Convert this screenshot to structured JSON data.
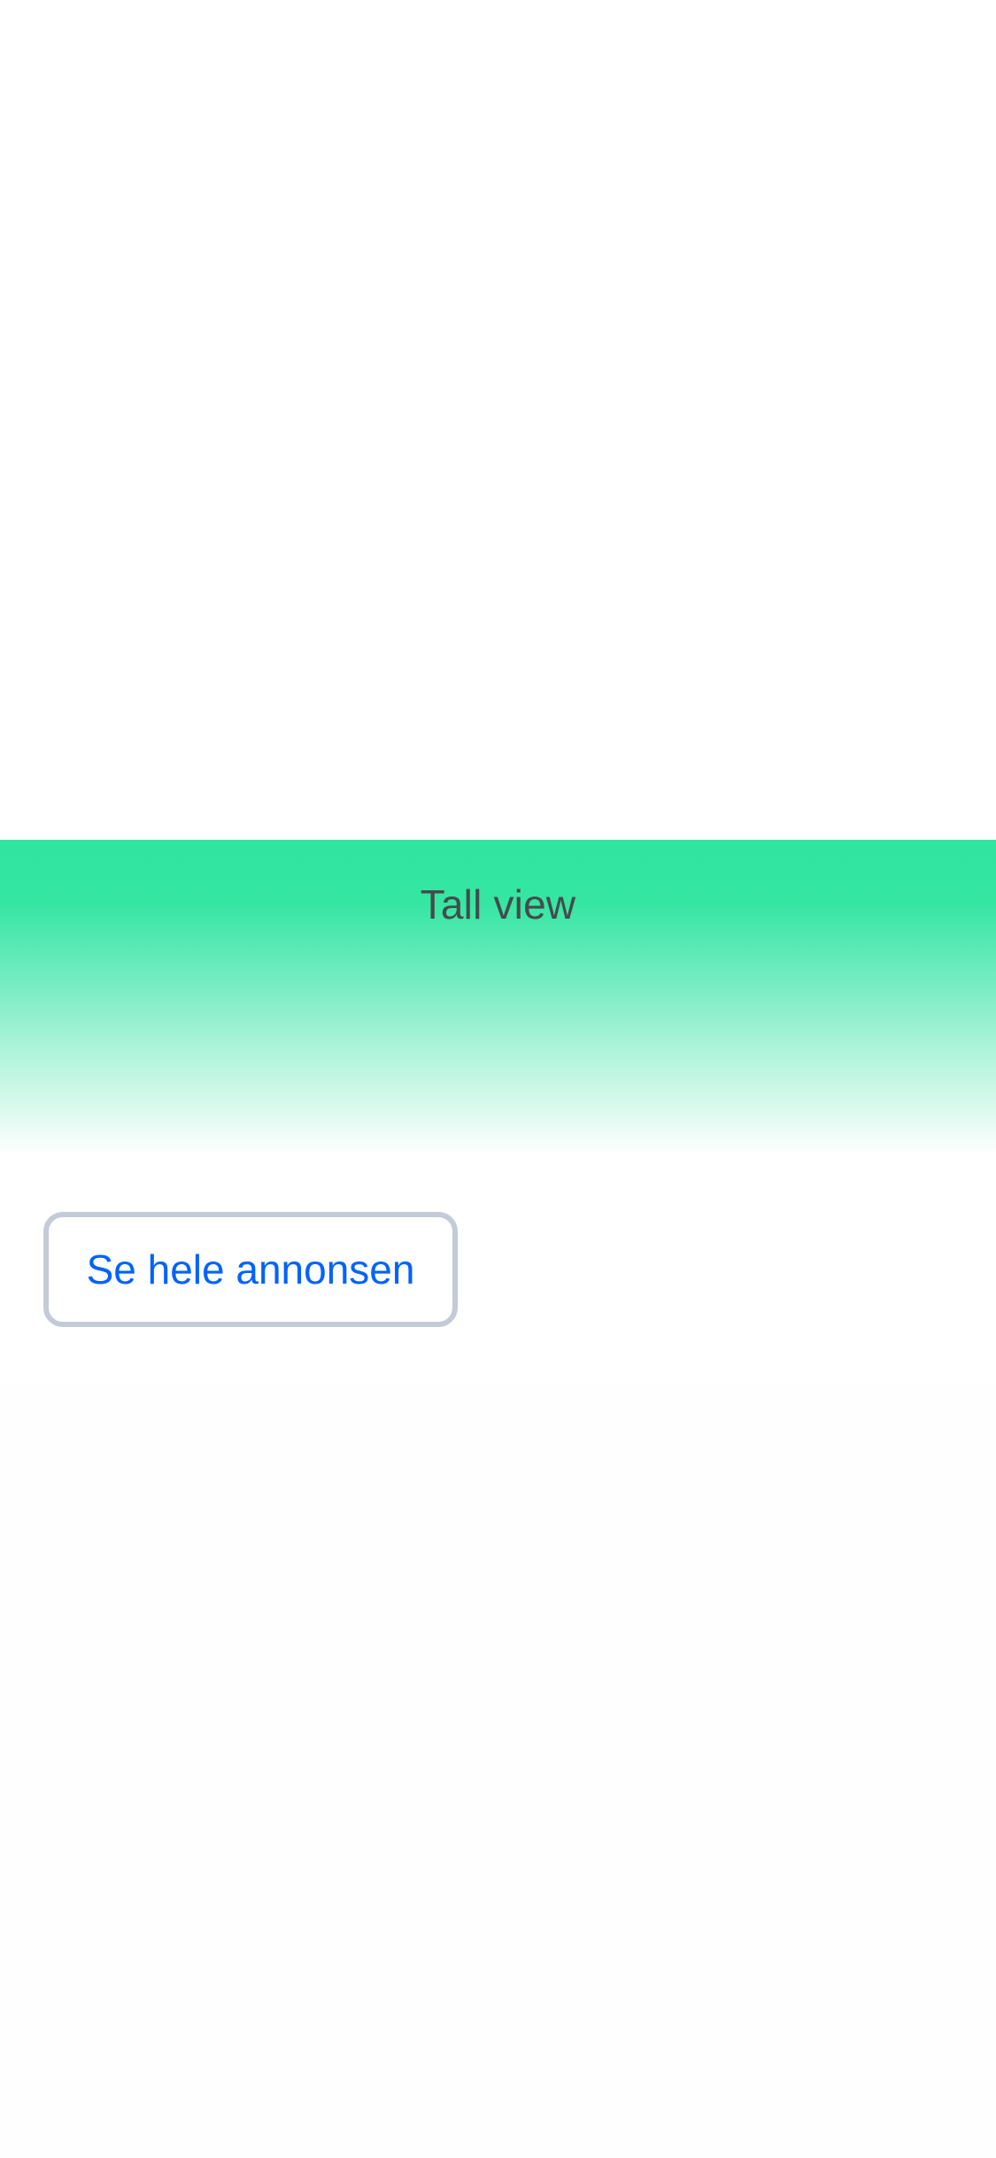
{
  "banner": {
    "label": "Tall view",
    "gradient_start": "#30e5a0",
    "gradient_end": "#ffffff",
    "text_color": "#474a4d"
  },
  "actions": {
    "see_full_ad_label": "Se hele annonsen",
    "link_color": "#0063fb",
    "border_color": "#c3cbd9"
  }
}
